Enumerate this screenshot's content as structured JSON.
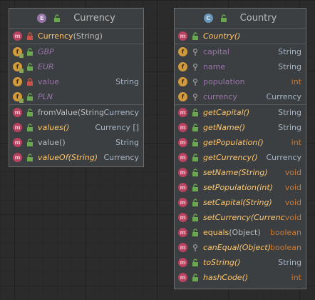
{
  "currency": {
    "title": "Currency",
    "constructor": {
      "name": "Currency",
      "params": "(String)"
    },
    "fields": [
      {
        "name": "GBP",
        "type": ""
      },
      {
        "name": "EUR",
        "type": ""
      },
      {
        "name": "value",
        "type": "String"
      },
      {
        "name": "PLN",
        "type": ""
      }
    ],
    "methods": [
      {
        "name": "fromValue",
        "params": "(String)",
        "type": "Currency"
      },
      {
        "name": "values",
        "params": "()",
        "type": "Currency []"
      },
      {
        "name": "value",
        "params": "()",
        "type": "String"
      },
      {
        "name": "valueOf",
        "params": "(String)",
        "type": "Currency"
      }
    ]
  },
  "country": {
    "title": "Country",
    "constructor": {
      "name": "Country",
      "params": "()"
    },
    "fields": [
      {
        "name": "capital",
        "type": "String"
      },
      {
        "name": "name",
        "type": "String"
      },
      {
        "name": "population",
        "type": "int"
      },
      {
        "name": "currency",
        "type": "Currency"
      }
    ],
    "methods": [
      {
        "name": "getCapital",
        "params": "()",
        "type": "String"
      },
      {
        "name": "getName",
        "params": "()",
        "type": "String"
      },
      {
        "name": "getPopulation",
        "params": "()",
        "type": "int"
      },
      {
        "name": "getCurrency",
        "params": "()",
        "type": "Currency"
      },
      {
        "name": "setName",
        "params": "(String)",
        "type": "void"
      },
      {
        "name": "setPopulation",
        "params": "(int)",
        "type": "void"
      },
      {
        "name": "setCapital",
        "params": "(String)",
        "type": "void"
      },
      {
        "name": "setCurrency",
        "params": "(Currency)",
        "type": "void"
      },
      {
        "name": "equals",
        "params": "(Object)",
        "type": "boolean"
      },
      {
        "name": "canEqual",
        "params": "(Object)",
        "type": "boolean"
      },
      {
        "name": "toString",
        "params": "()",
        "type": "String"
      },
      {
        "name": "hashCode",
        "params": "()",
        "type": "int"
      }
    ]
  },
  "icons": {
    "enum": "enum-icon",
    "class": "class-icon",
    "method": "method-icon",
    "field": "field-icon",
    "public": "unlock-icon",
    "private": "lock-icon",
    "package": "pin-icon"
  },
  "colors": {
    "background": "#2b2b2b",
    "box": "#3c3f41",
    "method_icon": "#b8425f",
    "field_icon": "#d19a3d",
    "enum_icon": "#9876aa",
    "class_icon": "#6897bb",
    "enum_constant": "#9876aa",
    "italic_method": "#ffc66d",
    "primitive_type": "#cc7832"
  }
}
